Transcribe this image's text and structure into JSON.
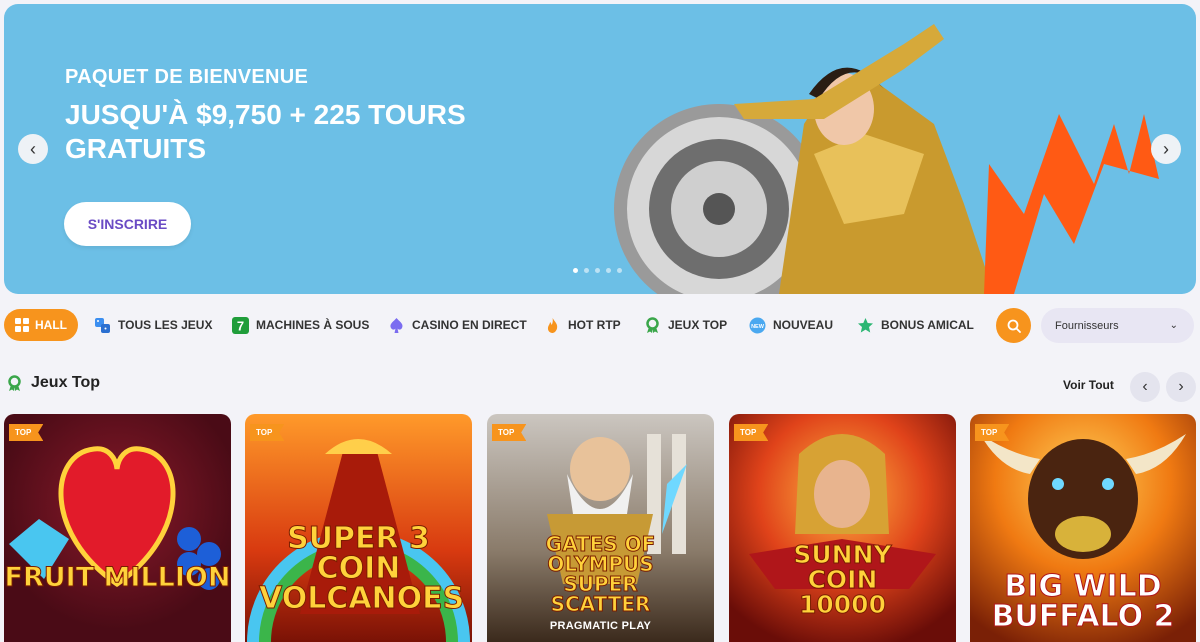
{
  "hero": {
    "subtitle": "PAQUET DE BIENVENUE",
    "headline": "JUSQU'À $9,750 + 225 TOURS GRATUITS",
    "cta_label": "S'INSCRIRE",
    "prev_icon": "chevron-left-icon",
    "next_icon": "chevron-right-icon",
    "slide_count": 5,
    "active_slide": 1
  },
  "nav": {
    "items": [
      {
        "label": "HALL",
        "icon": "grid-icon",
        "active": true
      },
      {
        "label": "TOUS LES JEUX",
        "icon": "dice-icon"
      },
      {
        "label": "MACHINES À SOUS",
        "icon": "seven-icon"
      },
      {
        "label": "CASINO EN DIRECT",
        "icon": "spade-icon"
      },
      {
        "label": "HOT RTP",
        "icon": "fire-icon"
      },
      {
        "label": "JEUX TOP",
        "icon": "award-icon"
      },
      {
        "label": "NOUVEAU",
        "icon": "new-badge-icon"
      },
      {
        "label": "BONUS AMICAL",
        "icon": "star-icon"
      }
    ],
    "providers_label": "Fournisseurs"
  },
  "section": {
    "title": "Jeux Top",
    "view_all": "Voir Tout"
  },
  "games": [
    {
      "title": "FRUIT MILLION",
      "badge": "TOP",
      "provider": ""
    },
    {
      "title": "SUPER 3 COIN VOLCANOES",
      "badge": "TOP",
      "provider": ""
    },
    {
      "title": "GATES OF OLYMPUS SUPER SCATTER",
      "badge": "TOP",
      "provider": "PRAGMATIC PLAY"
    },
    {
      "title": "SUNNY COIN 10000",
      "badge": "TOP",
      "provider": ""
    },
    {
      "title": "BIG WILD BUFFALO 2",
      "badge": "TOP",
      "provider": ""
    }
  ],
  "colors": {
    "accent": "#f7941d",
    "hero_bg": "#6cbfe6",
    "cta_text": "#6a4bc4"
  }
}
